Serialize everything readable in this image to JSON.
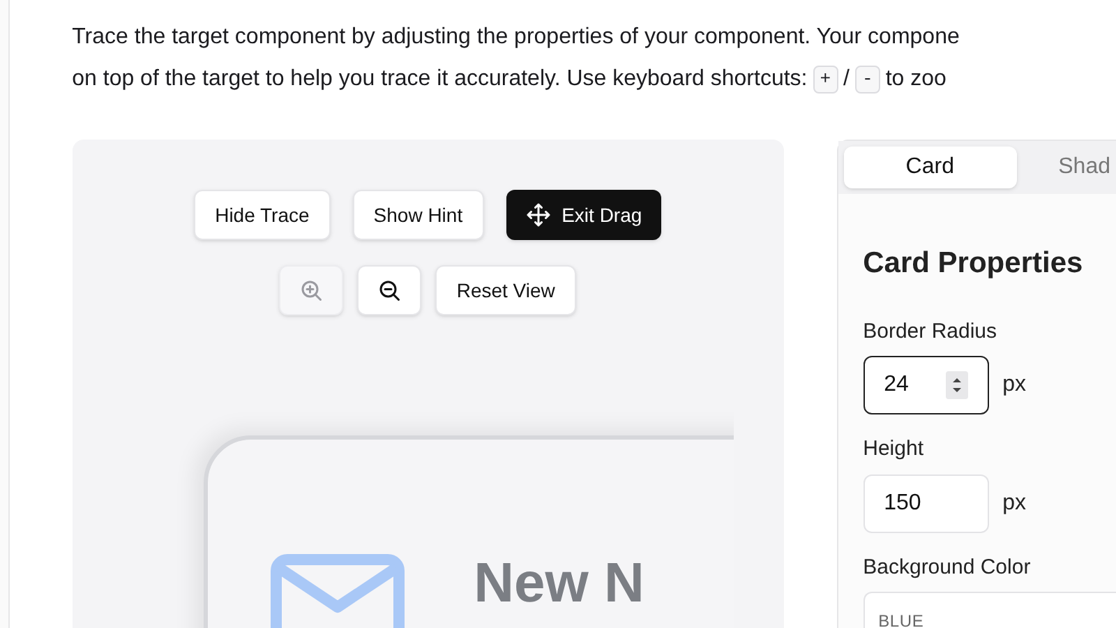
{
  "instructions": {
    "line_1": "Trace the target component by adjusting the properties of your component. Your compone",
    "line_2_before": "on top of the target to help you trace it accurately. Use keyboard shortcuts:",
    "keys": [
      "+",
      "-"
    ],
    "key_separator": "/",
    "line_2_after": "to zoo"
  },
  "canvas": {
    "buttons": [
      {
        "label": "Hide Trace",
        "kind": "plain"
      },
      {
        "label": "Show Hint",
        "kind": "plain"
      },
      {
        "label": "Exit Drag",
        "kind": "primary"
      }
    ],
    "zoom_controls": [
      {
        "kind": "zoom-in",
        "disabled": true
      },
      {
        "kind": "zoom-out",
        "disabled": false
      },
      {
        "kind": "text",
        "label": "Reset View",
        "disabled": false
      }
    ],
    "card": {
      "title": "New N"
    }
  },
  "panel": {
    "tabs": [
      {
        "label": "Card",
        "selected": true
      },
      {
        "label": "Shad",
        "selected": false
      }
    ],
    "heading": "Card Properties",
    "fields": [
      {
        "kind": "number",
        "label": "Border Radius",
        "value": "24",
        "unit": "px",
        "focused": true
      },
      {
        "kind": "number",
        "label": "Height",
        "value": "150",
        "unit": "px",
        "focused": false
      },
      {
        "kind": "color",
        "label": "Background Color",
        "group": "BLUE"
      }
    ]
  }
}
